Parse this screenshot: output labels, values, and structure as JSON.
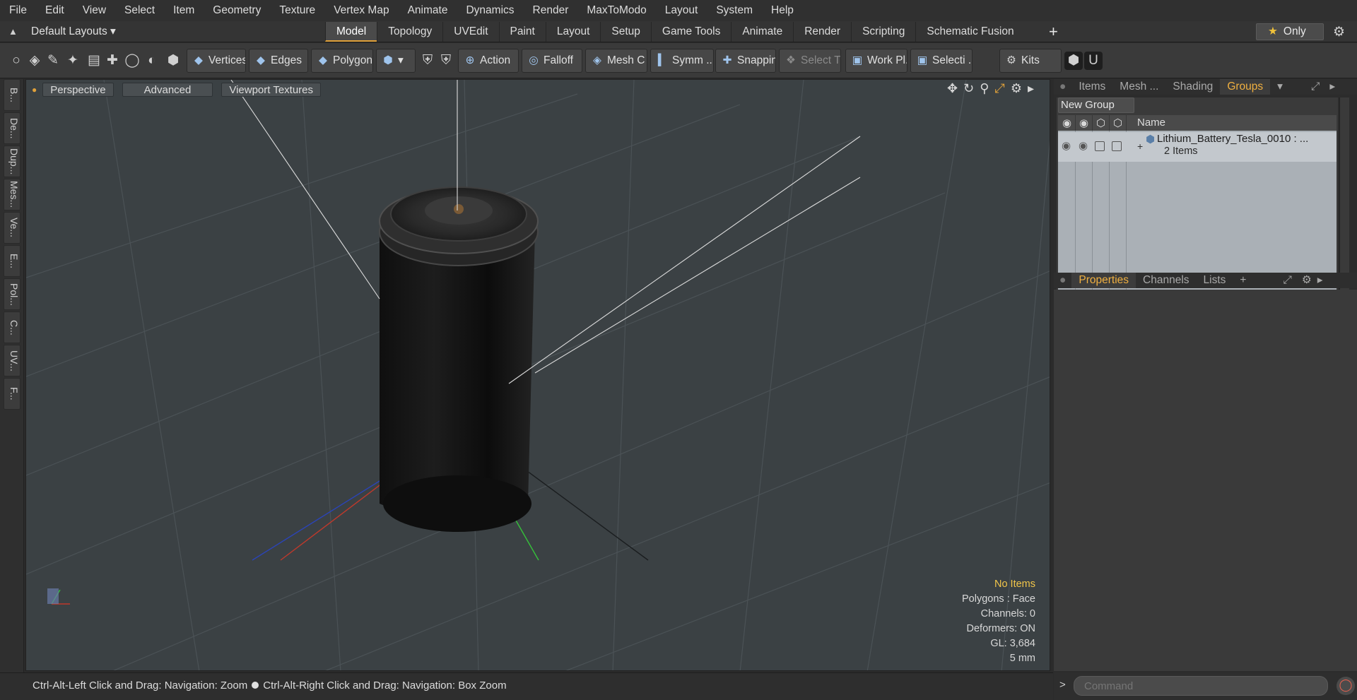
{
  "menu": [
    "File",
    "Edit",
    "View",
    "Select",
    "Item",
    "Geometry",
    "Texture",
    "Vertex Map",
    "Animate",
    "Dynamics",
    "Render",
    "MaxToModo",
    "Layout",
    "System",
    "Help"
  ],
  "layout_bar": {
    "layout_name": "Default Layouts",
    "tabs": [
      "Model",
      "Topology",
      "UVEdit",
      "Paint",
      "Layout",
      "Setup",
      "Game Tools",
      "Animate",
      "Render",
      "Scripting",
      "Schematic Fusion"
    ],
    "active_tab": "Model",
    "add_tab": "+",
    "only_label": "Only"
  },
  "toolbar": {
    "vertices": "Vertices",
    "edges": "Edges",
    "polygons": "Polygons",
    "action": "Action",
    "falloff": "Falloff",
    "mesh_c": "Mesh C ...",
    "symm": "Symm ...",
    "snapping": "Snapping",
    "select_t": "Select T...",
    "work_pl": "Work Pl...",
    "selecti": "Selecti ...",
    "kits": "Kits"
  },
  "left_tabs": [
    "B...",
    "De...",
    "Dup...",
    "Mes...",
    "Ve...",
    "E...",
    "Pol...",
    "C...",
    "UV...",
    "F..."
  ],
  "viewport": {
    "view_mode": "Perspective",
    "advanced": "Advanced",
    "textures": "Viewport Textures",
    "info": {
      "no_items": "No Items",
      "polygons": "Polygons : Face",
      "channels": "Channels: 0",
      "deformers": "Deformers: ON",
      "gl": "GL: 3,684",
      "scale": "5 mm"
    }
  },
  "status": {
    "hint1": "Ctrl-Alt-Left Click and Drag: Navigation: Zoom",
    "hint2": "Ctrl-Alt-Right Click and Drag: Navigation: Box Zoom"
  },
  "right_panel": {
    "top_tabs": [
      "Items",
      "Mesh ...",
      "Shading",
      "Groups"
    ],
    "top_active": "Groups",
    "new_group": "New Group",
    "name_col": "Name",
    "group_name": "Lithium_Battery_Tesla_0010 : ...",
    "group_count": "2 Items",
    "bottom_tabs": [
      "Properties",
      "Channels",
      "Lists"
    ],
    "bottom_active": "Properties",
    "bottom_add": "+"
  },
  "command": {
    "placeholder": "Command"
  },
  "colors": {
    "accent": "#e0a13a",
    "info_warn": "#f2c64a",
    "viewport_bg": "#3b4144"
  }
}
